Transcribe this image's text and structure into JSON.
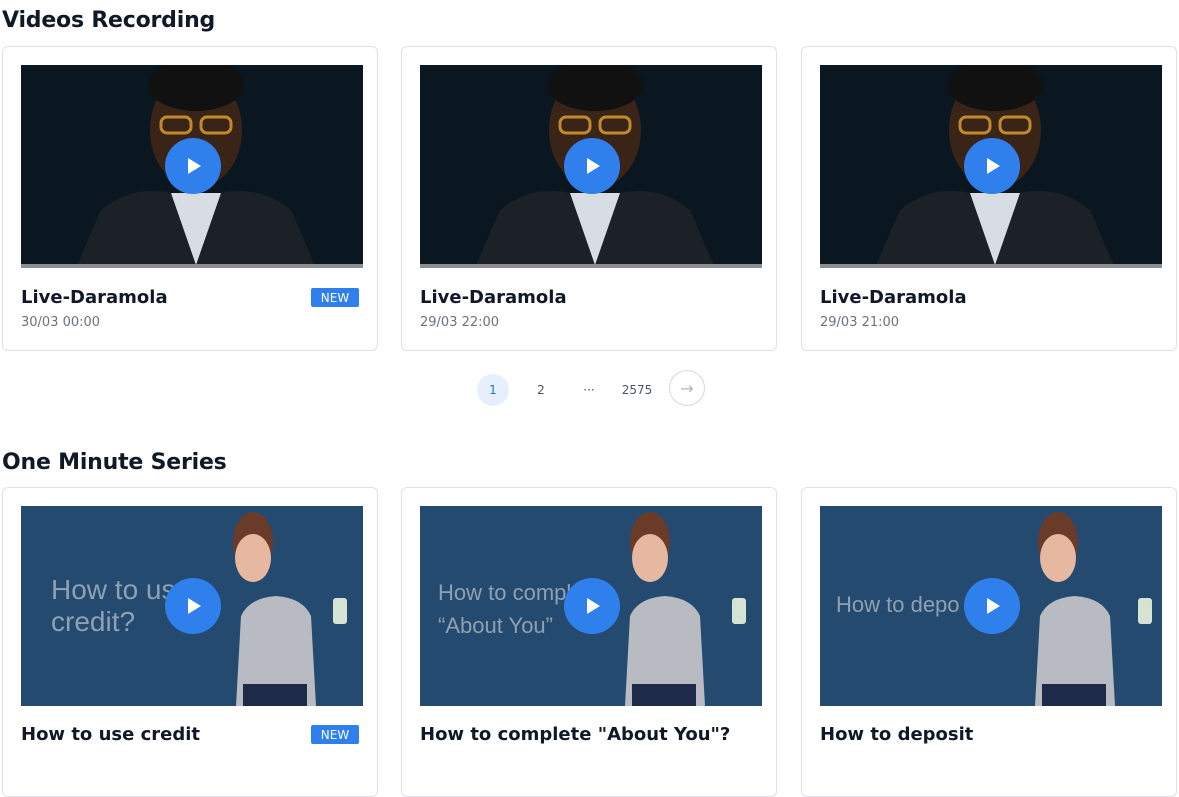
{
  "sections": {
    "recordings": {
      "title": "Videos Recording",
      "cards": [
        {
          "title": "Live-Daramola",
          "date": "30/03 00:00",
          "badge": "NEW"
        },
        {
          "title": "Live-Daramola",
          "date": "29/03 22:00"
        },
        {
          "title": "Live-Daramola",
          "date": "29/03 21:00"
        }
      ]
    },
    "series": {
      "title": "One Minute Series",
      "cards": [
        {
          "title": "How to use credit",
          "badge": "NEW",
          "overlay": [
            "How to us",
            "credit?"
          ]
        },
        {
          "title": "How to complete \"About You\"?",
          "overlay": [
            "How to compl",
            "“About You”"
          ]
        },
        {
          "title": "How to deposit",
          "overlay": [
            "How to depo"
          ]
        }
      ]
    }
  },
  "pagination": {
    "pages": [
      "1",
      "2",
      "···",
      "2575"
    ],
    "current": "1",
    "next_icon": "→"
  },
  "colors": {
    "accent": "#2f80ed",
    "thumb_dark": "#0b1720",
    "thumb_blue": "#244a6f"
  },
  "icons": {
    "play": "play-icon",
    "next": "arrow-right-icon"
  }
}
